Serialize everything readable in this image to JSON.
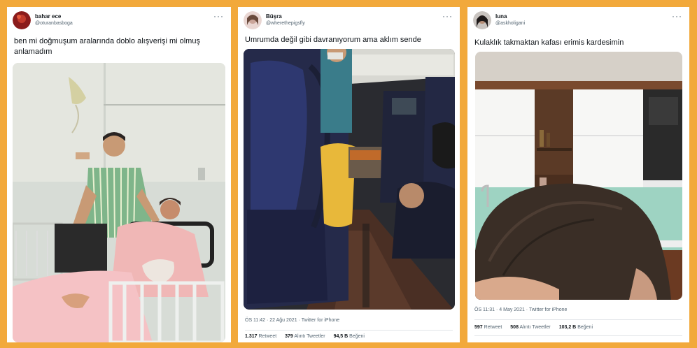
{
  "tweets": [
    {
      "name": "bahar ece",
      "handle": "@oturanbasboga",
      "more": "···",
      "text": "ben mi doğmuşum aralarında doblo alışverişi mi olmuş anlamadım"
    },
    {
      "name": "Büşra",
      "handle": "@wherethepigsfly",
      "more": "···",
      "text": "Umrumda değil gibi davranıyorum ama aklım sende",
      "meta": "ÖS 11:42 · 22 Ağu 2021 · Twitter for iPhone",
      "stats": {
        "retweets_count": "1.317",
        "retweets_label": "Retweet",
        "quotes_count": "379",
        "quotes_label": "Alıntı Tweetler",
        "likes_count": "94,5 B",
        "likes_label": "Beğeni"
      }
    },
    {
      "name": "luna",
      "handle": "@askholigani",
      "more": "···",
      "text": "Kulaklık takmaktan kafası erimis kardesimin",
      "meta": "ÖS 11:31 · 4 May 2021 · Twitter for iPhone",
      "stats": {
        "retweets_count": "597",
        "retweets_label": "Retweet",
        "quotes_count": "508",
        "quotes_label": "Alıntı Tweetler",
        "likes_count": "103,2 B",
        "likes_label": "Beğeni"
      }
    }
  ]
}
